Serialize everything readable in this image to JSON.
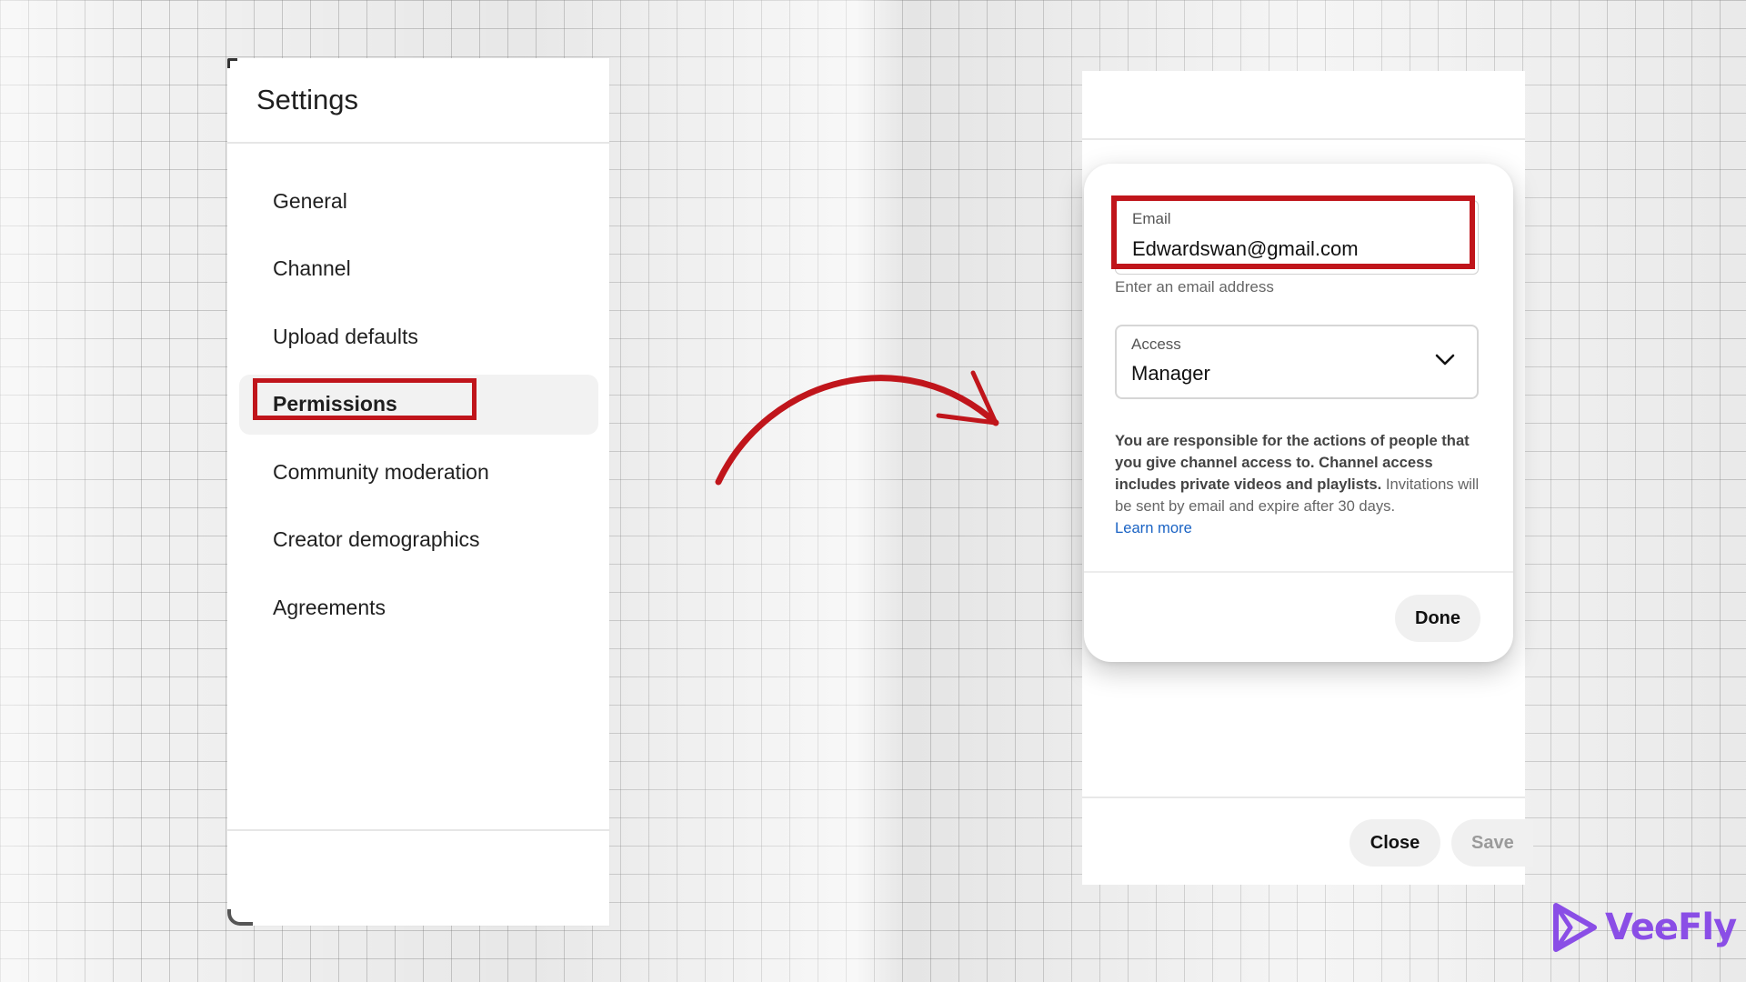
{
  "settings": {
    "title": "Settings",
    "nav": [
      {
        "label": "General"
      },
      {
        "label": "Channel"
      },
      {
        "label": "Upload defaults"
      },
      {
        "label": "Permissions",
        "active": true
      },
      {
        "label": "Community moderation"
      },
      {
        "label": "Creator demographics"
      },
      {
        "label": "Agreements"
      }
    ]
  },
  "dialog": {
    "email": {
      "label": "Email",
      "value": "Edwardswan@gmail.com",
      "hint": "Enter an email address"
    },
    "access": {
      "label": "Access",
      "value": "Manager",
      "icon": "chevron-down-icon"
    },
    "notice": {
      "bold": "You are responsible for the actions of people that you give channel access to. Channel access includes private videos and playlists.",
      "regular": " Invitations will be sent by email and expire after 30 days.",
      "link": "Learn more"
    },
    "done_label": "Done"
  },
  "footer": {
    "close_label": "Close",
    "save_label": "Save"
  },
  "logo": {
    "text": "VeeFly"
  },
  "colors": {
    "highlight": "#c0151b",
    "link": "#1a63c4",
    "brand": "#8a4ee6"
  }
}
